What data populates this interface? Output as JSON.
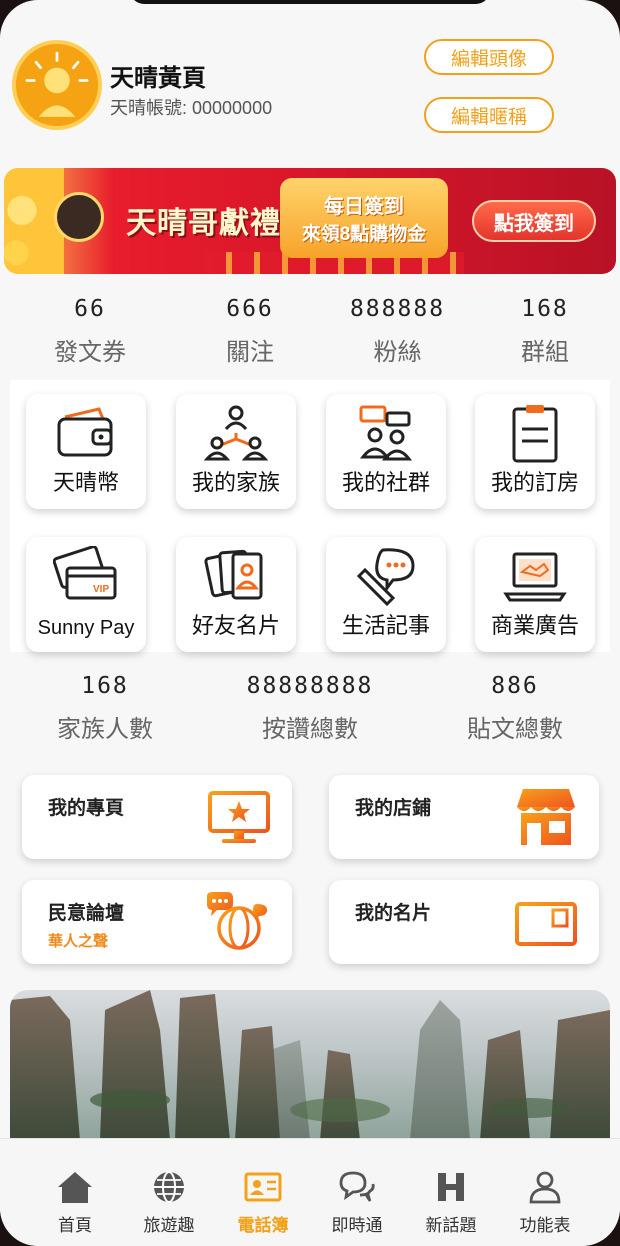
{
  "profile": {
    "name": "天晴黃頁",
    "account": "天晴帳號: 00000000",
    "edit_avatar": "編輯頭像",
    "edit_nickname": "編輯暱稱"
  },
  "banner": {
    "title": "天晴哥獻禮",
    "line1": "每日簽到",
    "line2": "來領8點購物金",
    "button": "點我簽到"
  },
  "stats_top": [
    {
      "value": "66",
      "label": "發文券"
    },
    {
      "value": "666",
      "label": "關注"
    },
    {
      "value": "888888",
      "label": "粉絲"
    },
    {
      "value": "168",
      "label": "群組"
    }
  ],
  "features": [
    {
      "label": "天晴幣",
      "icon": "wallet-icon"
    },
    {
      "label": "我的家族",
      "icon": "family-icon"
    },
    {
      "label": "我的社群",
      "icon": "community-icon"
    },
    {
      "label": "我的訂房",
      "icon": "clipboard-icon"
    },
    {
      "label": "Sunny Pay",
      "icon": "vip-card-icon"
    },
    {
      "label": "好友名片",
      "icon": "contact-cards-icon"
    },
    {
      "label": "生活記事",
      "icon": "pencil-chat-icon"
    },
    {
      "label": "商業廣告",
      "icon": "laptop-handshake-icon"
    }
  ],
  "stats_bottom": [
    {
      "value": "168",
      "label": "家族人數"
    },
    {
      "value": "88888888",
      "label": "按讚總數"
    },
    {
      "value": "886",
      "label": "貼文總數"
    }
  ],
  "cards": [
    {
      "title": "我的專頁",
      "subtitle": "",
      "icon": "monitor-star-icon"
    },
    {
      "title": "我的店鋪",
      "subtitle": "",
      "icon": "shop-icon"
    },
    {
      "title": "民意論壇",
      "subtitle": "華人之聲",
      "icon": "globe-chat-icon"
    },
    {
      "title": "我的名片",
      "subtitle": "",
      "icon": "namecard-icon"
    }
  ],
  "nav": [
    {
      "label": "首頁",
      "icon": "home-icon",
      "active": false
    },
    {
      "label": "旅遊趣",
      "icon": "globe-icon",
      "active": false
    },
    {
      "label": "電話簿",
      "icon": "contact-book-icon",
      "active": true
    },
    {
      "label": "即時通",
      "icon": "chat-bubbles-icon",
      "active": false
    },
    {
      "label": "新話題",
      "icon": "h-icon",
      "active": false
    },
    {
      "label": "功能表",
      "icon": "person-icon",
      "active": false
    }
  ],
  "colors": {
    "accent": "#f2a11a",
    "orange_gradient": "#f26a1b"
  }
}
